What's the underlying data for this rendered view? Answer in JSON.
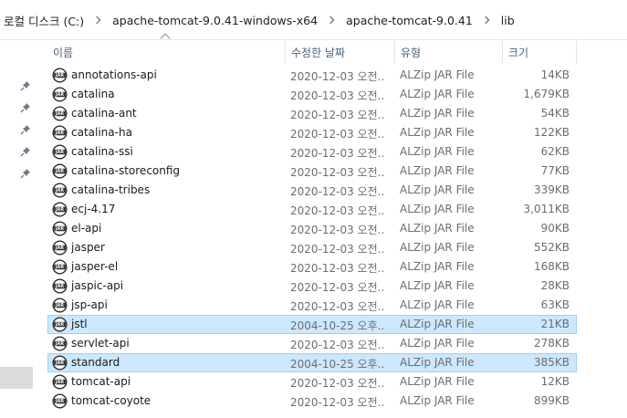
{
  "address_bar": {
    "crumbs": [
      "로컬 디스크 (C:)",
      "apache-tomcat-9.0.41-windows-x64",
      "apache-tomcat-9.0.41",
      "lib"
    ]
  },
  "columns": {
    "name": "이름",
    "date": "수정한 날짜",
    "type": "유형",
    "size": "크기"
  },
  "files": [
    {
      "name": "annotations-api",
      "date": "2020-12-03 오전...",
      "type": "ALZip JAR File",
      "size": "14KB",
      "selected": false
    },
    {
      "name": "catalina",
      "date": "2020-12-03 오전...",
      "type": "ALZip JAR File",
      "size": "1,679KB",
      "selected": false
    },
    {
      "name": "catalina-ant",
      "date": "2020-12-03 오전...",
      "type": "ALZip JAR File",
      "size": "54KB",
      "selected": false
    },
    {
      "name": "catalina-ha",
      "date": "2020-12-03 오전...",
      "type": "ALZip JAR File",
      "size": "122KB",
      "selected": false
    },
    {
      "name": "catalina-ssi",
      "date": "2020-12-03 오전...",
      "type": "ALZip JAR File",
      "size": "62KB",
      "selected": false
    },
    {
      "name": "catalina-storeconfig",
      "date": "2020-12-03 오전...",
      "type": "ALZip JAR File",
      "size": "77KB",
      "selected": false
    },
    {
      "name": "catalina-tribes",
      "date": "2020-12-03 오전...",
      "type": "ALZip JAR File",
      "size": "339KB",
      "selected": false
    },
    {
      "name": "ecj-4.17",
      "date": "2020-12-03 오전...",
      "type": "ALZip JAR File",
      "size": "3,011KB",
      "selected": false
    },
    {
      "name": "el-api",
      "date": "2020-12-03 오전...",
      "type": "ALZip JAR File",
      "size": "90KB",
      "selected": false
    },
    {
      "name": "jasper",
      "date": "2020-12-03 오전...",
      "type": "ALZip JAR File",
      "size": "552KB",
      "selected": false
    },
    {
      "name": "jasper-el",
      "date": "2020-12-03 오전...",
      "type": "ALZip JAR File",
      "size": "168KB",
      "selected": false
    },
    {
      "name": "jaspic-api",
      "date": "2020-12-03 오전...",
      "type": "ALZip JAR File",
      "size": "28KB",
      "selected": false
    },
    {
      "name": "jsp-api",
      "date": "2020-12-03 오전...",
      "type": "ALZip JAR File",
      "size": "63KB",
      "selected": false
    },
    {
      "name": "jstl",
      "date": "2004-10-25 오후...",
      "type": "ALZip JAR File",
      "size": "21KB",
      "selected": true
    },
    {
      "name": "servlet-api",
      "date": "2020-12-03 오전...",
      "type": "ALZip JAR File",
      "size": "278KB",
      "selected": false
    },
    {
      "name": "standard",
      "date": "2004-10-25 오후...",
      "type": "ALZip JAR File",
      "size": "385KB",
      "selected": true
    },
    {
      "name": "tomcat-api",
      "date": "2020-12-03 오전...",
      "type": "ALZip JAR File",
      "size": "12KB",
      "selected": false
    },
    {
      "name": "tomcat-coyote",
      "date": "2020-12-03 오전...",
      "type": "ALZip JAR File",
      "size": "899KB",
      "selected": false
    }
  ],
  "file_icon": "jar-file-icon",
  "pin_icon": "pin-icon",
  "colors": {
    "selection": "#cce8ff",
    "selection_border": "#99d1ff",
    "header_text": "#4c607a"
  }
}
